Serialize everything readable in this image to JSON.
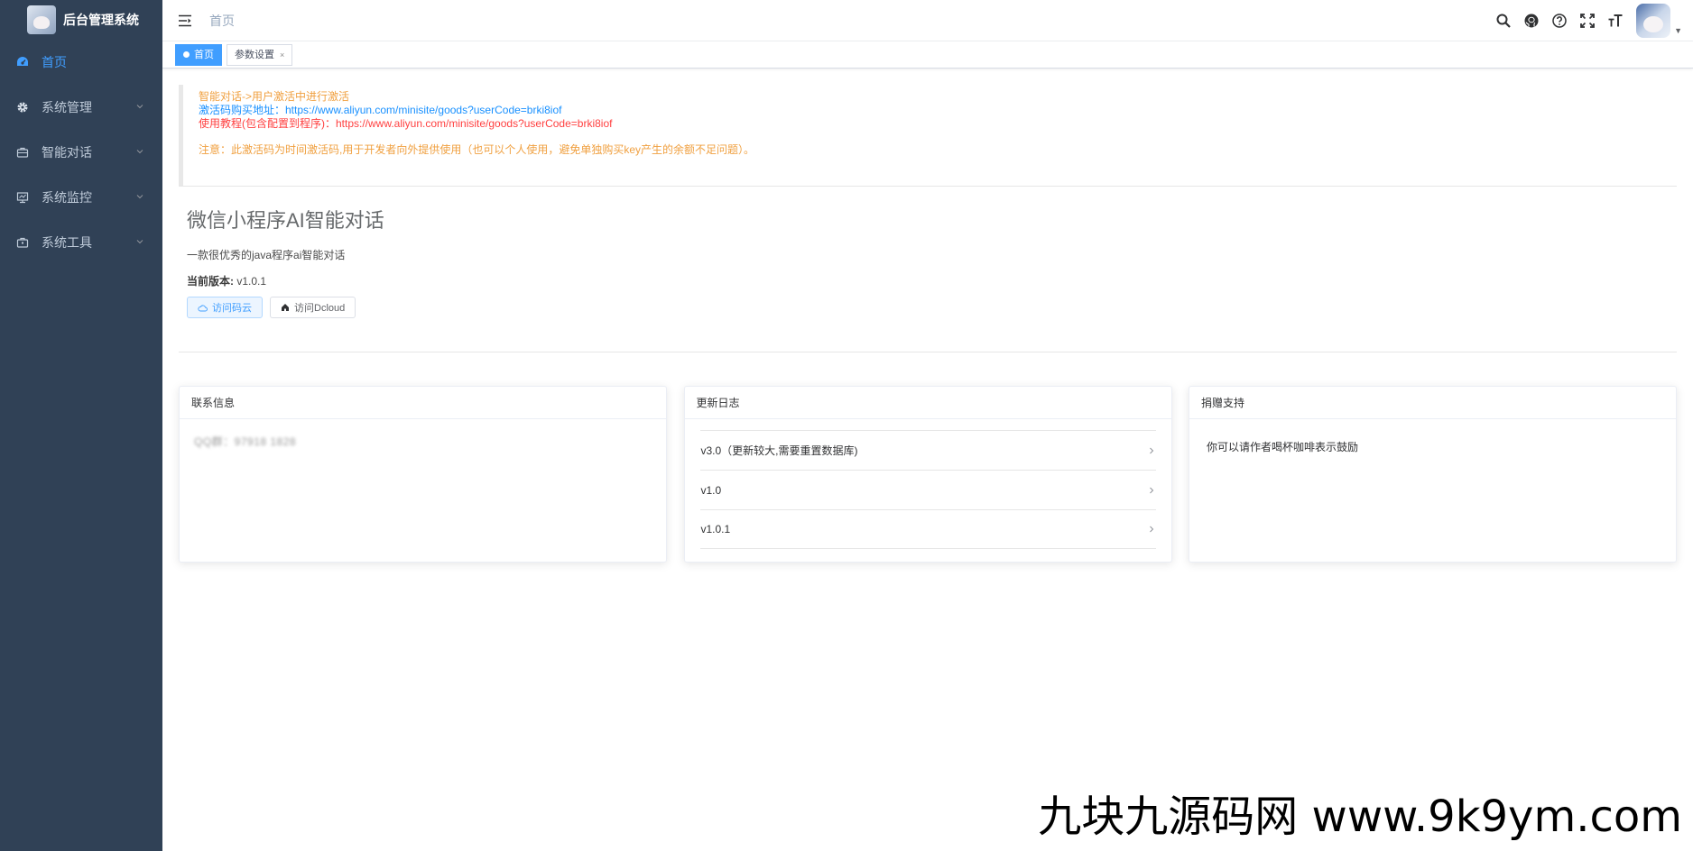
{
  "app": {
    "title": "后台管理系统"
  },
  "sidebar": {
    "items": [
      {
        "label": "首页",
        "icon": "dashboard-icon"
      },
      {
        "label": "系统管理",
        "icon": "gear-icon"
      },
      {
        "label": "智能对话",
        "icon": "briefcase-icon"
      },
      {
        "label": "系统监控",
        "icon": "monitor-icon"
      },
      {
        "label": "系统工具",
        "icon": "toolbox-icon"
      }
    ]
  },
  "navbar": {
    "breadcrumb": "首页",
    "icons": [
      "search-icon",
      "github-icon",
      "help-icon",
      "fullscreen-icon",
      "font-size-icon"
    ]
  },
  "tags": [
    {
      "label": "首页",
      "active": true
    },
    {
      "label": "参数设置",
      "close": "×"
    }
  ],
  "notice": {
    "line1": "智能对话->用户激活中进行激活",
    "line2": "激活码购买地址：https://www.aliyun.com/minisite/goods?userCode=brki8iof",
    "line3": "使用教程(包含配置到程序)：https://www.aliyun.com/minisite/goods?userCode=brki8iof",
    "line4": "注意：此激活码为时间激活码,用于开发者向外提供使用（也可以个人使用，避免单独购买key产生的余额不足问题）。"
  },
  "intro": {
    "title": "微信小程序AI智能对话",
    "desc": "一款很优秀的java程序ai智能对话",
    "version_label": "当前版本:",
    "version": "v1.0.1",
    "btn_gitee": "访问码云",
    "btn_dcloud": "访问Dcloud"
  },
  "cards": {
    "contact": {
      "title": "联系信息",
      "text": "QQ群：97918 1828"
    },
    "changelog": {
      "title": "更新日志",
      "items": [
        "v3.0（更新较大,需要重置数据库)",
        "v1.0",
        "v1.0.1"
      ]
    },
    "donate": {
      "title": "捐赠支持",
      "text": "你可以请作者喝杯咖啡表示鼓励"
    }
  },
  "watermark": "九块九源码网 www.9k9ym.com",
  "colors": {
    "sidebar_bg": "#304156",
    "active": "#409eff",
    "sidebar_text": "#bfcbd9"
  }
}
